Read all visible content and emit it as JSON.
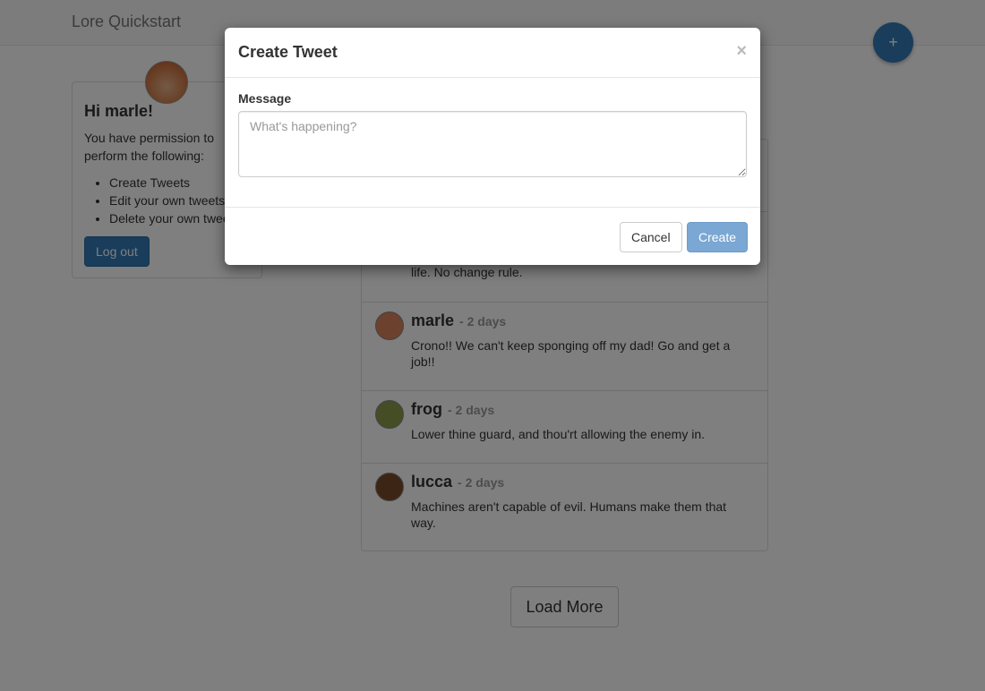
{
  "navbar": {
    "brand": "Lore Quickstart",
    "add_icon": "+"
  },
  "profile": {
    "greeting": "Hi marle!",
    "intro": "You have permission to perform the following:",
    "permissions": [
      "Create Tweets",
      "Edit your own tweets",
      "Delete your own tweets"
    ],
    "logout": "Log out"
  },
  "feed": {
    "items": [
      {
        "text": "Ayla fight while alive. Win and live. Lose and die. Rule of life. No change rule."
      },
      {
        "user": "marle",
        "time": "- 2 days",
        "text": "Crono!! We can't keep sponging off my dad! Go and get a job!!"
      },
      {
        "user": "frog",
        "time": "- 2 days",
        "text": "Lower thine guard, and thou'rt allowing the enemy in."
      },
      {
        "user": "lucca",
        "time": "- 2 days",
        "text": "Machines aren't capable of evil. Humans make them that way."
      }
    ],
    "load_more": "Load More"
  },
  "modal": {
    "title": "Create Tweet",
    "close": "×",
    "message_label": "Message",
    "message_value": "",
    "message_placeholder": "What's happening?",
    "cancel": "Cancel",
    "create": "Create"
  },
  "colors": {
    "primary": "#337ab7",
    "overlay": "rgba(0,0,0,0.5)"
  }
}
